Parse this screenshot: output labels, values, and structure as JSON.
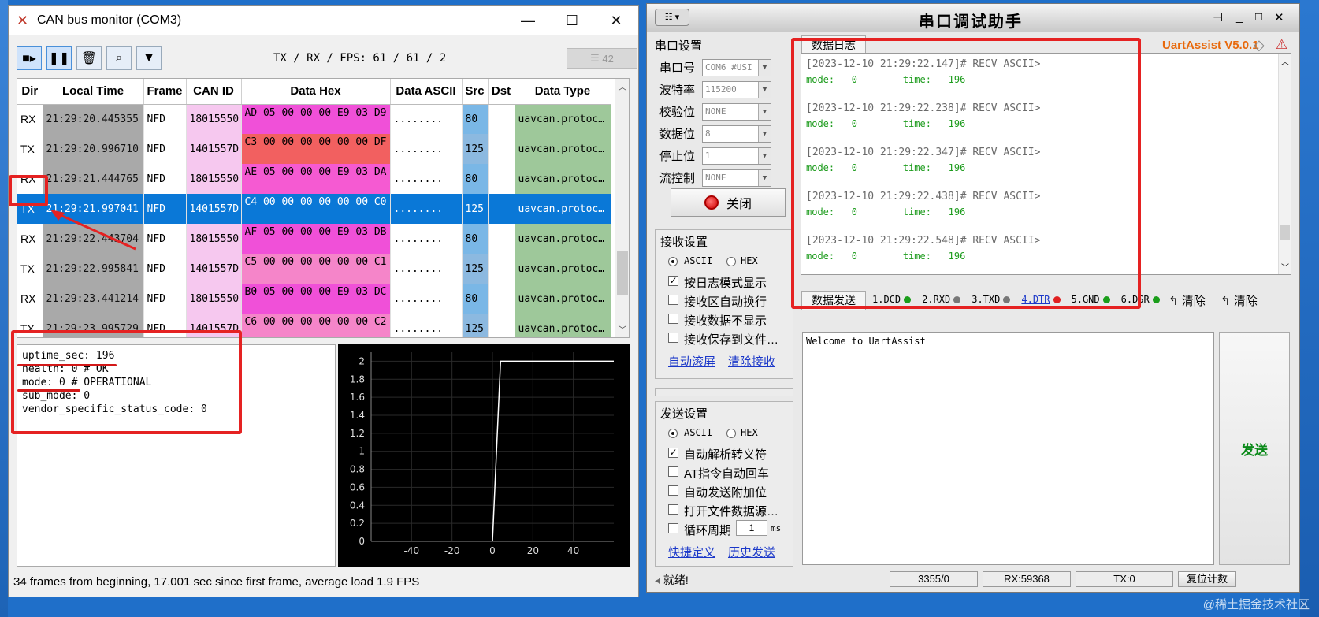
{
  "can": {
    "window_title": "CAN bus monitor (COM3)",
    "fps_text": "TX / RX / FPS:  61 / 61 / 2",
    "frame_count": "42",
    "columns": [
      "Dir",
      "Local Time",
      "Frame",
      "CAN ID",
      "Data Hex",
      "Data ASCII",
      "Src",
      "Dst",
      "Data Type"
    ],
    "rows": [
      {
        "dir": "RX",
        "time": "21:29:20.445355",
        "frame": "NFD",
        "id": "18015550",
        "hex": "AD 05 00 00 00 E9 03 D9",
        "ascii": "........",
        "src": "80",
        "dst": "",
        "type": "uavcan.protoc…"
      },
      {
        "dir": "TX",
        "time": "21:29:20.996710",
        "frame": "NFD",
        "id": "1401557D",
        "hex": "C3 00 00 00 00 00 00 DF",
        "ascii": "........",
        "src": "125",
        "dst": "",
        "type": "uavcan.protoc…"
      },
      {
        "dir": "RX",
        "time": "21:29:21.444765",
        "frame": "NFD",
        "id": "18015550",
        "hex": "AE 05 00 00 00 E9 03 DA",
        "ascii": "........",
        "src": "80",
        "dst": "",
        "type": "uavcan.protoc…"
      },
      {
        "dir": "TX",
        "time": "21:29:21.997041",
        "frame": "NFD",
        "id": "1401557D",
        "hex": "C4 00 00 00 00 00 00 C0",
        "ascii": "........",
        "src": "125",
        "dst": "",
        "type": "uavcan.protoc…"
      },
      {
        "dir": "RX",
        "time": "21:29:22.443704",
        "frame": "NFD",
        "id": "18015550",
        "hex": "AF 05 00 00 00 E9 03 DB",
        "ascii": "........",
        "src": "80",
        "dst": "",
        "type": "uavcan.protoc…"
      },
      {
        "dir": "TX",
        "time": "21:29:22.995841",
        "frame": "NFD",
        "id": "1401557D",
        "hex": "C5 00 00 00 00 00 00 C1",
        "ascii": "........",
        "src": "125",
        "dst": "",
        "type": "uavcan.protoc…"
      },
      {
        "dir": "RX",
        "time": "21:29:23.441214",
        "frame": "NFD",
        "id": "18015550",
        "hex": "B0 05 00 00 00 E9 03 DC",
        "ascii": "........",
        "src": "80",
        "dst": "",
        "type": "uavcan.protoc…"
      },
      {
        "dir": "TX",
        "time": "21:29:23.995729",
        "frame": "NFD",
        "id": "1401557D",
        "hex": "C6 00 00 00 00 00 00 C2",
        "ascii": "........",
        "src": "125",
        "dst": "",
        "type": "uavcan.protoc…"
      }
    ],
    "selected_row": 3,
    "detail_lines": [
      "uptime_sec: 196",
      "health: 0 # OK",
      "mode: 0 # OPERATIONAL",
      "sub_mode: 0",
      "vendor_specific_status_code: 0"
    ],
    "status_text": "34 frames from beginning, 17.001 sec since first frame, average load 1.9 FPS"
  },
  "chart_data": {
    "type": "line",
    "title": "",
    "xlabel": "",
    "ylabel": "",
    "xlim": [
      -60,
      60
    ],
    "ylim": [
      0,
      2.1
    ],
    "x_ticks": [
      "-40",
      "-20",
      "0",
      "20",
      "40"
    ],
    "y_ticks": [
      "0",
      "0.2",
      "0.4",
      "0.6",
      "0.8",
      "1",
      "1.2",
      "1.4",
      "1.6",
      "1.8",
      "2"
    ],
    "series": [
      {
        "x": [
          0,
          4,
          60
        ],
        "y": [
          0,
          2,
          2
        ]
      }
    ],
    "grid": true,
    "background": "#000000",
    "line_color": "#ffffff"
  },
  "uart": {
    "window_title": "串口调试助手",
    "version": "UartAssist V5.0.1",
    "port_settings_title": "串口设置",
    "port_label": "串口号",
    "port_value": "COM6 #USI",
    "baud_label": "波特率",
    "baud_value": "115200",
    "parity_label": "校验位",
    "parity_value": "NONE",
    "databits_label": "数据位",
    "databits_value": "8",
    "stopbits_label": "停止位",
    "stopbits_value": "1",
    "flow_label": "流控制",
    "flow_value": "NONE",
    "close_button": "关闭",
    "recv_settings_title": "接收设置",
    "recv_ascii": "ASCII",
    "recv_hex": "HEX",
    "recv_opt1": "按日志模式显示",
    "recv_opt2": "接收区自动换行",
    "recv_opt3": "接收数据不显示",
    "recv_opt4": "接收保存到文件…",
    "auto_scroll": "自动滚屏",
    "clear_recv": "清除接收",
    "send_settings_title": "发送设置",
    "send_ascii": "ASCII",
    "send_hex": "HEX",
    "send_opt1": "自动解析转义符",
    "send_opt2": "AT指令自动回车",
    "send_opt3": "自动发送附加位",
    "send_opt4": "打开文件数据源…",
    "send_opt5": "循环周期",
    "cycle_value": "1",
    "cycle_unit": "ms",
    "shortcut_def": "快捷定义",
    "history_send": "历史发送",
    "log_tab": "数据日志",
    "log_entries": [
      {
        "head": "[2023-12-10 21:29:22.147]# RECV ASCII>",
        "body": "mode:   0        time:   196"
      },
      {
        "head": "[2023-12-10 21:29:22.238]# RECV ASCII>",
        "body": "mode:   0        time:   196"
      },
      {
        "head": "[2023-12-10 21:29:22.347]# RECV ASCII>",
        "body": "mode:   0        time:   196"
      },
      {
        "head": "[2023-12-10 21:29:22.438]# RECV ASCII>",
        "body": "mode:   0        time:   196"
      },
      {
        "head": "[2023-12-10 21:29:22.548]# RECV ASCII>",
        "body": "mode:   0        time:   196"
      }
    ],
    "send_tab": "数据发送",
    "signals": [
      "1.DCD",
      "2.RXD",
      "3.TXD",
      "4.DTR",
      "5.GND",
      "6.DSR"
    ],
    "clear1": "清除",
    "clear2": "清除",
    "send_text": "Welcome to UartAssist",
    "send_button": "发送",
    "status_ready": "就绪!",
    "status_count": "3355/0",
    "status_rx": "RX:59368",
    "status_tx": "TX:0",
    "reset_count": "复位计数"
  },
  "watermark": "@稀土掘金技术社区",
  "colors": {
    "annotation_red": "#e52222",
    "selected_row": "#0a78d7",
    "log_green": "#1e9c1e",
    "version_orange": "#e8690c"
  }
}
